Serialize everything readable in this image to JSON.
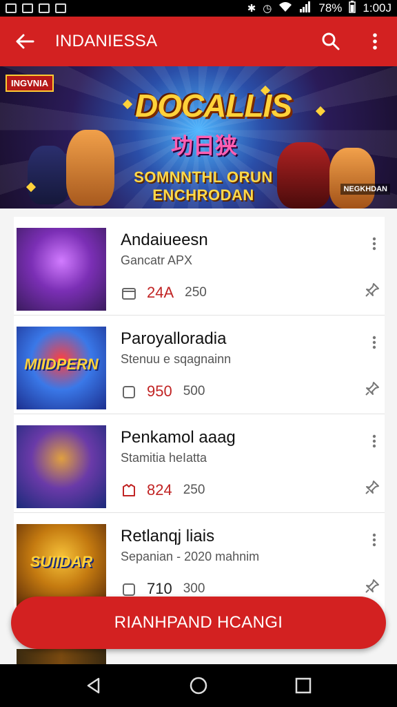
{
  "status_bar": {
    "battery": "78%",
    "time": "1:00J"
  },
  "app_bar": {
    "title": "INDANIESSA"
  },
  "banner": {
    "corner_tag": "INGVNIA",
    "logo": "DOCALLIS",
    "logo_sub": "功日狭",
    "subtitle": "SOMNNTHL ORUN ENCHRODAN",
    "bottom_tag": "NEGKHDAN"
  },
  "items": [
    {
      "name": "Andaiueesn",
      "sub": "Gancatr APX",
      "v1": "24A",
      "v2": "250",
      "thumb_label": "",
      "thumb_colors": [
        "#3a1b5e",
        "#7b2fb5",
        "#d17bff"
      ]
    },
    {
      "name": "Paroyalloradia",
      "sub": "Stenuu e sqagnainn",
      "v1": "950",
      "v2": "500",
      "thumb_label": "MIIDPERN",
      "thumb_colors": [
        "#1c2f8f",
        "#3a78e8",
        "#ff3f3f"
      ]
    },
    {
      "name": "Penkamol aaag",
      "sub": "Stamitia heIatta",
      "v1": "824",
      "v2": "250",
      "thumb_label": "",
      "thumb_colors": [
        "#1b2a7a",
        "#6a3aa8",
        "#e0a040"
      ]
    },
    {
      "name": "Retlanqj liais",
      "sub": "Sepanian - 2020 mahnim",
      "v1": "710",
      "v2": "300",
      "thumb_label": "SUIIDAR",
      "thumb_colors": [
        "#5a2a08",
        "#c47a10",
        "#f7c33a"
      ]
    }
  ],
  "cta": {
    "label": "RIANHPAND HCANGI"
  },
  "colors": {
    "primary_red": "#d32121",
    "value_red": "#c12424"
  }
}
